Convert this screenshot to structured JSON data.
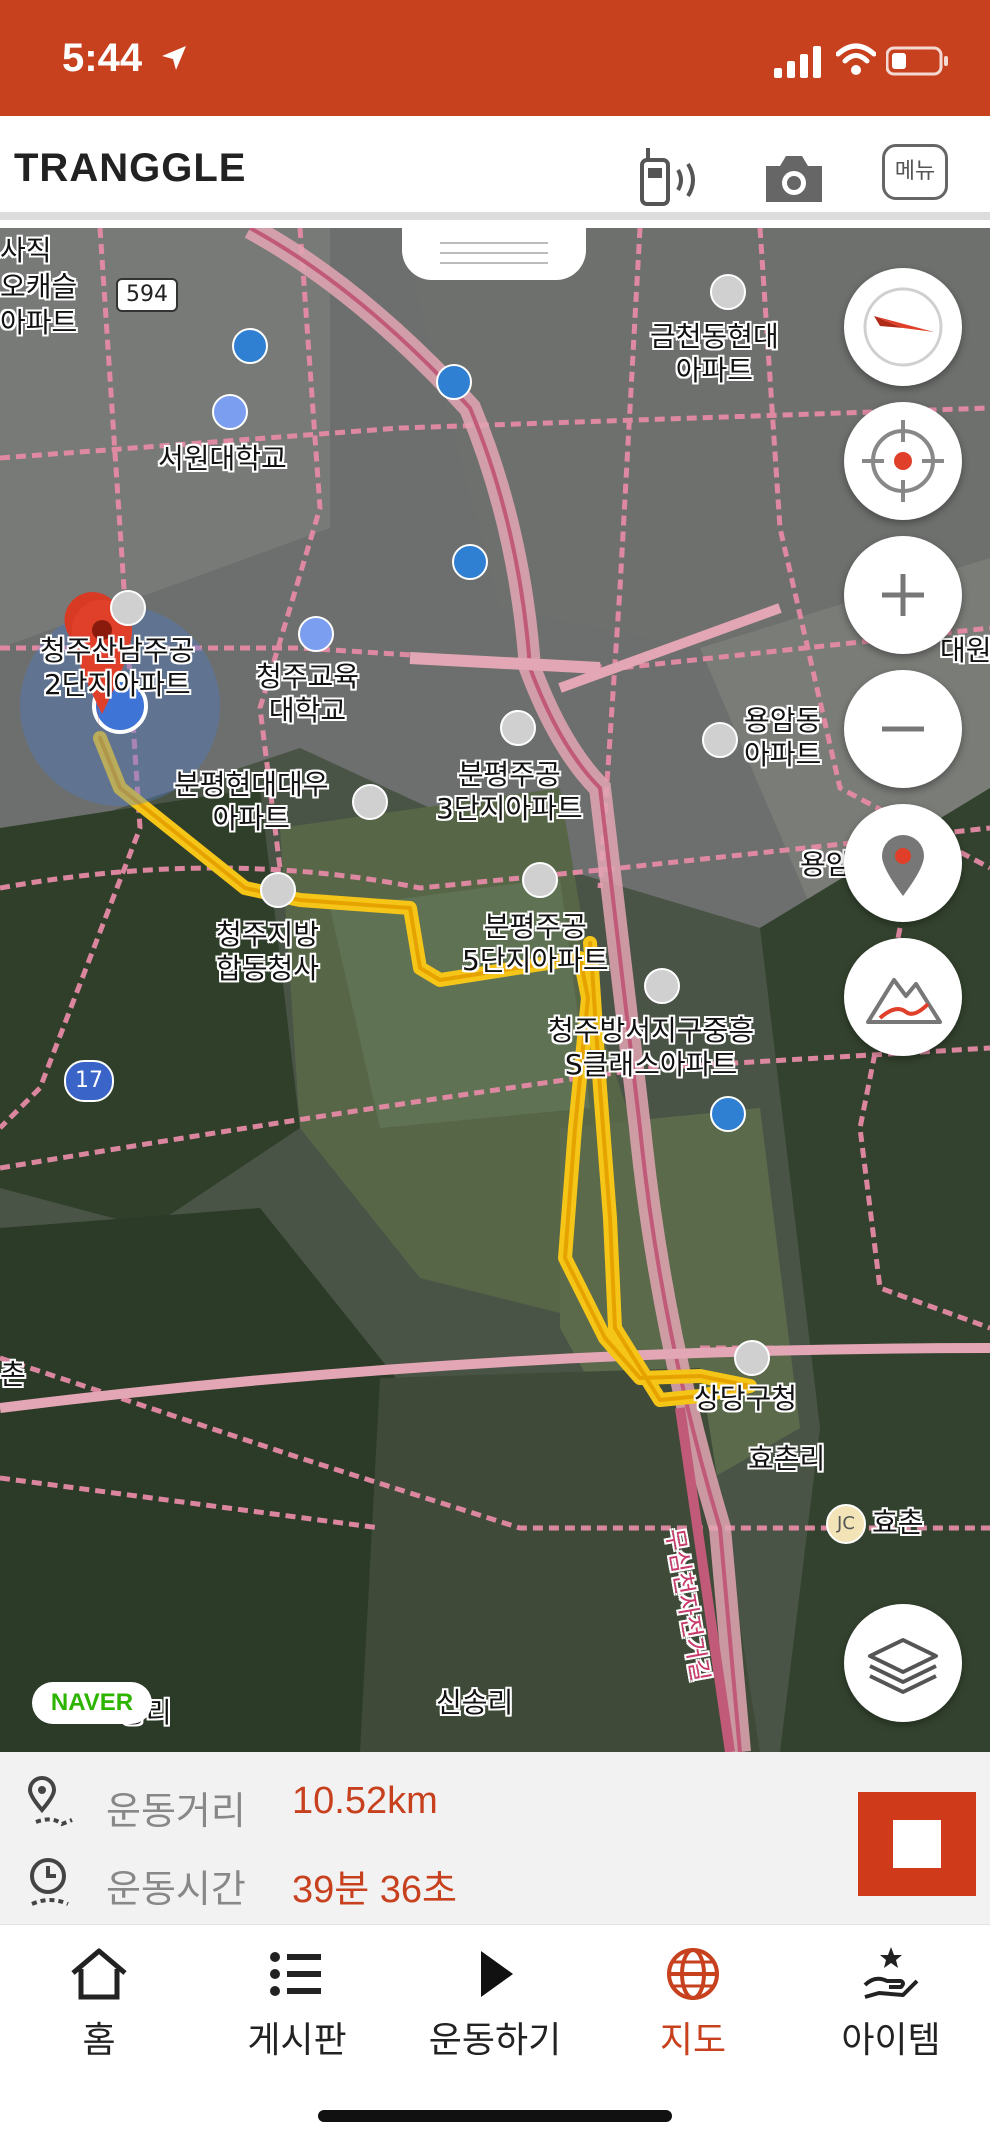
{
  "status_bar": {
    "time": "5:44"
  },
  "header": {
    "logo": "TRANGGLE",
    "menu_label": "메뉴"
  },
  "map": {
    "labels": {
      "saji": "사직",
      "okaesul": "오캐슬",
      "apt": "아파트",
      "road594": "594",
      "geumcheon": "금천동현대\n아파트",
      "seowon_univ": "서원대학교",
      "cheongju_lh": "청주산남주공\n2단지아파트",
      "cheongju_edu": "청주교육\n대학교",
      "daewon": "대원",
      "bunpyeong3": "분평주공\n3단지아파트",
      "yongam": "용암동\n아파트",
      "bunpyeong_hd": "분평현대대우\n아파트",
      "yongam2": "용암",
      "gov_complex": "청주지방\n합동청사",
      "bunpyeong5": "분평주공\n5단지아파트",
      "bangseo": "청주방서지구중흥\nS클래스아파트",
      "road17": "17",
      "chon": "촌",
      "sangdang_office": "상당구청",
      "hyochon_ri": "효촌리",
      "hyochon_jc": "효촌",
      "jc": "JC",
      "musim": "무심천자전거길",
      "sinsong": "신송리",
      "jungri": "중리"
    },
    "naver": "NAVER"
  },
  "stats": {
    "distance_label": "운동거리",
    "distance_value": "10.52km",
    "time_label": "운동시간",
    "time_value": "39분 36초"
  },
  "tabs": [
    {
      "label": "홈",
      "icon": "home-icon"
    },
    {
      "label": "게시판",
      "icon": "list-icon"
    },
    {
      "label": "운동하기",
      "icon": "play-icon"
    },
    {
      "label": "지도",
      "icon": "globe-icon",
      "active": true
    },
    {
      "label": "아이템",
      "icon": "hand-star-icon"
    }
  ],
  "colors": {
    "accent": "#c8411f",
    "route": "#f5c518"
  }
}
